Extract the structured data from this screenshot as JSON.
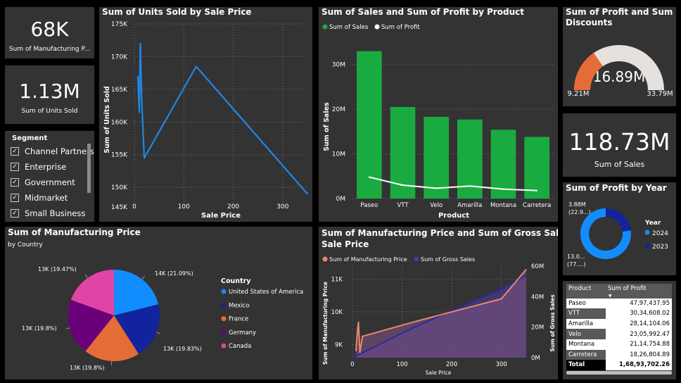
{
  "kpi_mfg": {
    "value": "68K",
    "label": "Sum of Manufacturing P..."
  },
  "kpi_units": {
    "value": "1.13M",
    "label": "Sum of Units Sold"
  },
  "kpi_sales": {
    "value": "118.73M",
    "label": "Sum of  Sales"
  },
  "slicer": {
    "title": "Segment",
    "items": [
      "Channel Partners",
      "Enterprise",
      "Government",
      "Midmarket",
      "Small Business"
    ]
  },
  "gauge": {
    "title_line1": "Sum of Profit and Sum of",
    "title_line2": "Discounts",
    "value": "16.89M",
    "min": "9.21M",
    "max": "33.79M",
    "fill_fraction": 0.31,
    "fill_color": "#E66C37",
    "track_color": "#E6E1DC"
  },
  "donut": {
    "title": "Sum of Profit by Year",
    "label_top_1": "3.88M",
    "label_top_2": "(22.9...)",
    "label_bot_1": "13.0...",
    "label_bot_2": "(77....)",
    "legend_title": "Year",
    "legend": [
      {
        "name": "2024",
        "color": "#118DFF"
      },
      {
        "name": "2023",
        "color": "#12239E"
      }
    ],
    "fractions": [
      0.771,
      0.229
    ]
  },
  "pivot": {
    "headers": [
      "Product",
      "Sum of Profit"
    ],
    "rows": [
      [
        "Paseo",
        "47,97,437.95"
      ],
      [
        "VTT",
        "30,34,608.02"
      ],
      [
        "Amarilla",
        "28,14,104.06"
      ],
      [
        "Velo",
        "23,05,992.47"
      ],
      [
        "Montana",
        "21,14,754.88"
      ],
      [
        "Carretera",
        "18,26,804.89"
      ]
    ],
    "total": [
      "Total",
      "1,68,93,702.26"
    ]
  },
  "pie": {
    "title": "Sum of Manufacturing Price",
    "subtitle": "by Country",
    "legend_title": "Country"
  },
  "units_chart_labels": {
    "title": "Sum of Units Sold by Sale Price",
    "xlabel": "Sale Price",
    "ylabel": "Sum of Units Sold"
  },
  "bar_chart_labels": {
    "title": "Sum of Sales and Sum of Profit by Product",
    "xlabel": "Product",
    "ylabel": "Sum of Sales"
  },
  "mfg_chart_labels": {
    "title_line1": "Sum of Manufacturing Price and Sum of Gross Sales by",
    "title_line2": "Sale Price",
    "xlabel": "Sale Price",
    "ylabel_left": "Sum of Manufacturing Price",
    "ylabel_right": "Sum of Gross Sales"
  },
  "chart_data": [
    {
      "type": "line",
      "title": "Sum of Units Sold by Sale Price",
      "xlabel": "Sale Price",
      "ylabel": "Sum of Units Sold",
      "x": [
        7,
        10,
        12,
        15,
        20,
        125,
        350
      ],
      "y": [
        167000,
        161500,
        172000,
        163000,
        154500,
        168500,
        149000
      ],
      "xlim": [
        0,
        350
      ],
      "ylim": [
        147000,
        175000
      ],
      "xticks": [
        0,
        100,
        200,
        300
      ],
      "yticks": [
        150000,
        155000,
        160000,
        165000,
        170000,
        175000
      ],
      "ytick_labels": [
        "150K",
        "155K",
        "160K",
        "165K",
        "170K",
        "175K"
      ],
      "extra_ytick_label": "145K",
      "color": "#1E88E5",
      "grid": true
    },
    {
      "type": "bar",
      "title": "Sum of Sales and Sum of Profit by Product",
      "xlabel": "Product",
      "ylabel": "Sum of Sales",
      "categories": [
        "Paseo",
        "VTT",
        "Velo",
        "Amarilla",
        "Montana",
        "Carretera"
      ],
      "series": [
        {
          "name": "Sum of  Sales",
          "kind": "bar",
          "color": "#1AAB40",
          "values": [
            33000000,
            20500000,
            18300000,
            17700000,
            15400000,
            13800000
          ]
        },
        {
          "name": "Sum of Profit",
          "kind": "line",
          "color": "#FFFFFF",
          "values": [
            4800000,
            3000000,
            2300000,
            2800000,
            2100000,
            1800000
          ]
        }
      ],
      "ylim": [
        0,
        35000000
      ],
      "yticks": [
        0,
        10000000,
        20000000,
        30000000
      ],
      "ytick_labels": [
        "0M",
        "10M",
        "20M",
        "30M"
      ],
      "legend": "top-left",
      "grid": true
    },
    {
      "type": "pie",
      "title": "Sum of Manufacturing Price",
      "subtitle": "by Country",
      "slices": [
        {
          "name": "United States of America",
          "value": 14000,
          "label": "14K (21.09%)",
          "color": "#118DFF"
        },
        {
          "name": "Mexico",
          "value": 13000,
          "label": "13K (19.83%)",
          "color": "#12239E"
        },
        {
          "name": "France",
          "value": 13000,
          "label": "13K (19.8%)",
          "color": "#E66C37"
        },
        {
          "name": "Germany",
          "value": 13000,
          "label": "13K (19.8%)",
          "color": "#6B007B"
        },
        {
          "name": "Canada",
          "value": 13000,
          "label": "13K (19.47%)",
          "color": "#E044A7"
        }
      ],
      "fractions": [
        0.2109,
        0.1983,
        0.198,
        0.198,
        0.1947
      ],
      "legend": "right"
    },
    {
      "type": "area",
      "title": "Sum of Manufacturing Price and Sum of Gross Sales by Sale Price",
      "xlabel": "Sale Price",
      "series": [
        {
          "name": "Sum of Manufacturing Price",
          "color": "#E8896B",
          "axis": "left",
          "x": [
            7,
            10,
            12,
            15,
            20,
            125,
            300,
            350
          ],
          "y": [
            8800,
            9400,
            9700,
            8750,
            9250,
            9700,
            10400,
            11300
          ]
        },
        {
          "name": "Sum of Gross Sales",
          "color": "#4A3A9E",
          "axis": "right",
          "x": [
            0,
            125,
            300,
            350
          ],
          "y": [
            0,
            20000000,
            45000000,
            54000000
          ]
        }
      ],
      "xlim": [
        0,
        350
      ],
      "xticks": [
        0,
        100,
        200,
        300
      ],
      "ylim_left": [
        8600,
        11400
      ],
      "yticks_left": [
        9000,
        10000,
        11000
      ],
      "ytick_labels_left": [
        "9K",
        "10K",
        "11K"
      ],
      "ylim_right": [
        0,
        60000000
      ],
      "yticks_right": [
        0,
        20000000,
        40000000,
        60000000
      ],
      "ytick_labels_right": [
        "0M",
        "20M",
        "40M",
        "60M"
      ],
      "legend": "top-left",
      "grid": true
    }
  ]
}
